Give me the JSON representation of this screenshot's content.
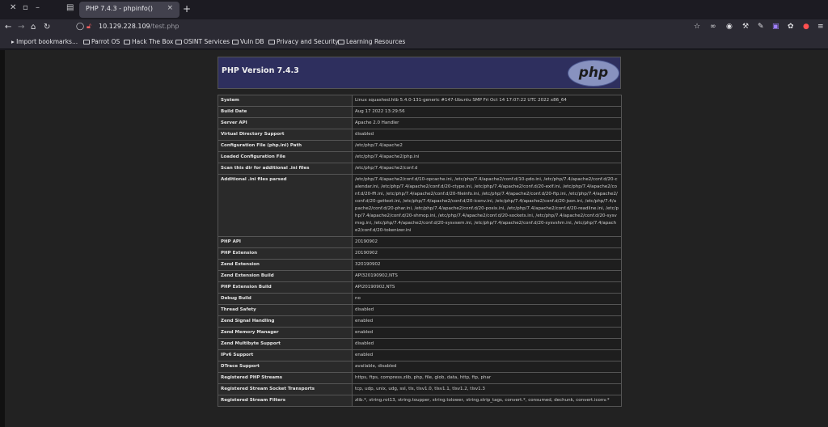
{
  "browser": {
    "tab_title": "PHP 7.4.3 - phpinfo()",
    "tab_close": "×",
    "new_tab": "+",
    "url_host": "10.129.228.109",
    "url_path": "/test.php",
    "bookmarks": [
      "Import bookmarks...",
      "Parrot OS",
      "Hack The Box",
      "OSINT Services",
      "Vuln DB",
      "Privacy and Security",
      "Learning Resources"
    ]
  },
  "page": {
    "version_title": "PHP Version 7.4.3",
    "logo_text": "php",
    "rows": [
      {
        "k": "System",
        "v": "Linux squashed.htb 5.4.0-131-generic #147-Ubuntu SMP Fri Oct 14 17:07:22 UTC 2022 x86_64"
      },
      {
        "k": "Build Date",
        "v": "Aug 17 2022 13:29:56"
      },
      {
        "k": "Server API",
        "v": "Apache 2.0 Handler"
      },
      {
        "k": "Virtual Directory Support",
        "v": "disabled"
      },
      {
        "k": "Configuration File (php.ini) Path",
        "v": "/etc/php/7.4/apache2"
      },
      {
        "k": "Loaded Configuration File",
        "v": "/etc/php/7.4/apache2/php.ini"
      },
      {
        "k": "Scan this dir for additional .ini files",
        "v": "/etc/php/7.4/apache2/conf.d"
      },
      {
        "k": "Additional .ini files parsed",
        "v": "/etc/php/7.4/apache2/conf.d/10-opcache.ini, /etc/php/7.4/apache2/conf.d/10-pdo.ini, /etc/php/7.4/apache2/conf.d/20-calendar.ini, /etc/php/7.4/apache2/conf.d/20-ctype.ini, /etc/php/7.4/apache2/conf.d/20-exif.ini, /etc/php/7.4/apache2/conf.d/20-ffi.ini, /etc/php/7.4/apache2/conf.d/20-fileinfo.ini, /etc/php/7.4/apache2/conf.d/20-ftp.ini, /etc/php/7.4/apache2/conf.d/20-gettext.ini, /etc/php/7.4/apache2/conf.d/20-iconv.ini, /etc/php/7.4/apache2/conf.d/20-json.ini, /etc/php/7.4/apache2/conf.d/20-phar.ini, /etc/php/7.4/apache2/conf.d/20-posix.ini, /etc/php/7.4/apache2/conf.d/20-readline.ini, /etc/php/7.4/apache2/conf.d/20-shmop.ini, /etc/php/7.4/apache2/conf.d/20-sockets.ini, /etc/php/7.4/apache2/conf.d/20-sysvmsg.ini, /etc/php/7.4/apache2/conf.d/20-sysvsem.ini, /etc/php/7.4/apache2/conf.d/20-sysvshm.ini, /etc/php/7.4/apache2/conf.d/20-tokenizer.ini"
      },
      {
        "k": "PHP API",
        "v": "20190902"
      },
      {
        "k": "PHP Extension",
        "v": "20190902"
      },
      {
        "k": "Zend Extension",
        "v": "320190902"
      },
      {
        "k": "Zend Extension Build",
        "v": "API320190902,NTS"
      },
      {
        "k": "PHP Extension Build",
        "v": "API20190902,NTS"
      },
      {
        "k": "Debug Build",
        "v": "no"
      },
      {
        "k": "Thread Safety",
        "v": "disabled"
      },
      {
        "k": "Zend Signal Handling",
        "v": "enabled"
      },
      {
        "k": "Zend Memory Manager",
        "v": "enabled"
      },
      {
        "k": "Zend Multibyte Support",
        "v": "disabled"
      },
      {
        "k": "IPv6 Support",
        "v": "enabled"
      },
      {
        "k": "DTrace Support",
        "v": "available, disabled"
      },
      {
        "k": "Registered PHP Streams",
        "v": "https, ftps, compress.zlib, php, file, glob, data, http, ftp, phar"
      },
      {
        "k": "Registered Stream Socket Transports",
        "v": "tcp, udp, unix, udg, ssl, tls, tlsv1.0, tlsv1.1, tlsv1.2, tlsv1.3"
      },
      {
        "k": "Registered Stream Filters",
        "v": "zlib.*, string.rot13, string.toupper, string.tolower, string.strip_tags, convert.*, consumed, dechunk, convert.iconv.*"
      }
    ]
  },
  "colors": {
    "header_bg": "#2e2f5e",
    "logo_bg": "#8892bf",
    "page_bg": "#222222",
    "toolbar_bg": "#2b2a33"
  }
}
